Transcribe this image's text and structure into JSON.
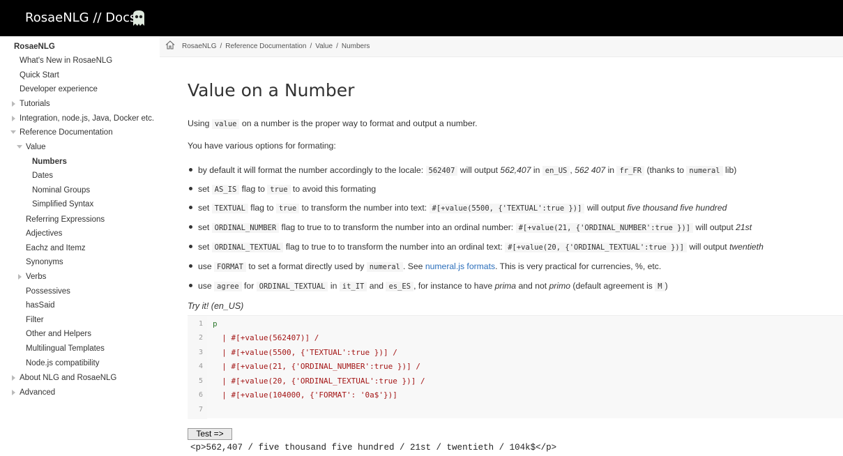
{
  "header": {
    "brand": "RosaeNLG // Docs",
    "logo_icon": "rosaenlg-logo-icon"
  },
  "sidebar": {
    "root": "RosaeNLG",
    "items": [
      {
        "label": "What's New in RosaeNLG"
      },
      {
        "label": "Quick Start"
      },
      {
        "label": "Developer experience"
      },
      {
        "label": "Tutorials"
      },
      {
        "label": "Integration, node.js, Java, Docker etc."
      },
      {
        "label": "Reference Documentation"
      },
      {
        "label": "Value"
      },
      {
        "label": "Numbers"
      },
      {
        "label": "Dates"
      },
      {
        "label": "Nominal Groups"
      },
      {
        "label": "Simplified Syntax"
      },
      {
        "label": "Referring Expressions"
      },
      {
        "label": "Adjectives"
      },
      {
        "label": "Eachz and Itemz"
      },
      {
        "label": "Synonyms"
      },
      {
        "label": "Verbs"
      },
      {
        "label": "Possessives"
      },
      {
        "label": "hasSaid"
      },
      {
        "label": "Filter"
      },
      {
        "label": "Other and Helpers"
      },
      {
        "label": "Multilingual Templates"
      },
      {
        "label": "Node.js compatibility"
      },
      {
        "label": "About NLG and RosaeNLG"
      },
      {
        "label": "Advanced"
      }
    ]
  },
  "breadcrumb": {
    "home_icon": "home-icon",
    "items": [
      "RosaeNLG",
      "Reference Documentation",
      "Value",
      "Numbers"
    ]
  },
  "page": {
    "title": "Value on a Number",
    "intro": {
      "pre": "Using ",
      "code": "value",
      "post": " on a number is the proper way to format and output a number."
    },
    "options_intro": "You have various options for formating:",
    "bullets": {
      "b1": {
        "t1": "by default it will format the number accordingly to the locale: ",
        "c1": "562407",
        "t2": " will output ",
        "e1": "562,407",
        "t3": " in ",
        "c2": "en_US",
        "t4": ", ",
        "e2": "562 407",
        "t5": " in ",
        "c3": "fr_FR",
        "t6": " (thanks to ",
        "c4": "numeral",
        "t7": " lib)"
      },
      "b2": {
        "t1": "set ",
        "c1": "AS_IS",
        "t2": " flag to ",
        "c2": "true",
        "t3": " to avoid this formating"
      },
      "b3": {
        "t1": "set ",
        "c1": "TEXTUAL",
        "t2": " flag to ",
        "c2": "true",
        "t3": " to transform the number into text: ",
        "c3": "#[+value(5500, {'TEXTUAL':true })]",
        "t4": " will output ",
        "e1": "five thousand five hundred"
      },
      "b4": {
        "t1": "set ",
        "c1": "ORDINAL_NUMBER",
        "t2": " flag to true to to transform the number into an ordinal number: ",
        "c2": "#[+value(21, {'ORDINAL_NUMBER':true })]",
        "t3": " will output ",
        "e1": "21st"
      },
      "b5": {
        "t1": "set ",
        "c1": "ORDINAL_TEXTUAL",
        "t2": " flag to true to to transform the number into an ordinal text: ",
        "c2": "#[+value(20, {'ORDINAL_TEXTUAL':true })]",
        "t3": " will output ",
        "e1": "twentieth"
      },
      "b6": {
        "t1": "use ",
        "c1": "FORMAT",
        "t2": " to set a format directly used by ",
        "c2": "numeral",
        "t3": ". See ",
        "link": "numeral.js formats",
        "t4": ". This is very practical for currencies, %, etc."
      },
      "b7": {
        "t1": "use ",
        "c1": "agree",
        "t2": " for ",
        "c2": "ORDINAL_TEXTUAL",
        "t3": " in ",
        "c3": "it_IT",
        "t4": " and ",
        "c4": "es_ES",
        "t5": ", for instance to have ",
        "e1": "prima",
        "t6": " and not ",
        "e2": "primo",
        "t7": " (default agreement is ",
        "c5": "M",
        "t8": ")"
      }
    },
    "try_it": "Try it! (en_US)",
    "editor": {
      "line_numbers": [
        "1",
        "2",
        "3",
        "4",
        "5",
        "6",
        "7"
      ],
      "lines": [
        "p",
        "  | #[+value(562407)] /",
        "  | #[+value(5500, {'TEXTUAL':true })] /",
        "  | #[+value(21, {'ORDINAL_NUMBER':true })] /",
        "  | #[+value(20, {'ORDINAL_TEXTUAL':true })] /",
        "  | #[+value(104000, {'FORMAT': '0a$'})]",
        ""
      ]
    },
    "test_button": "Test =>",
    "output": "<p>562,407 / five thousand five hundred / 21st / twentieth / 104k$</p>"
  }
}
